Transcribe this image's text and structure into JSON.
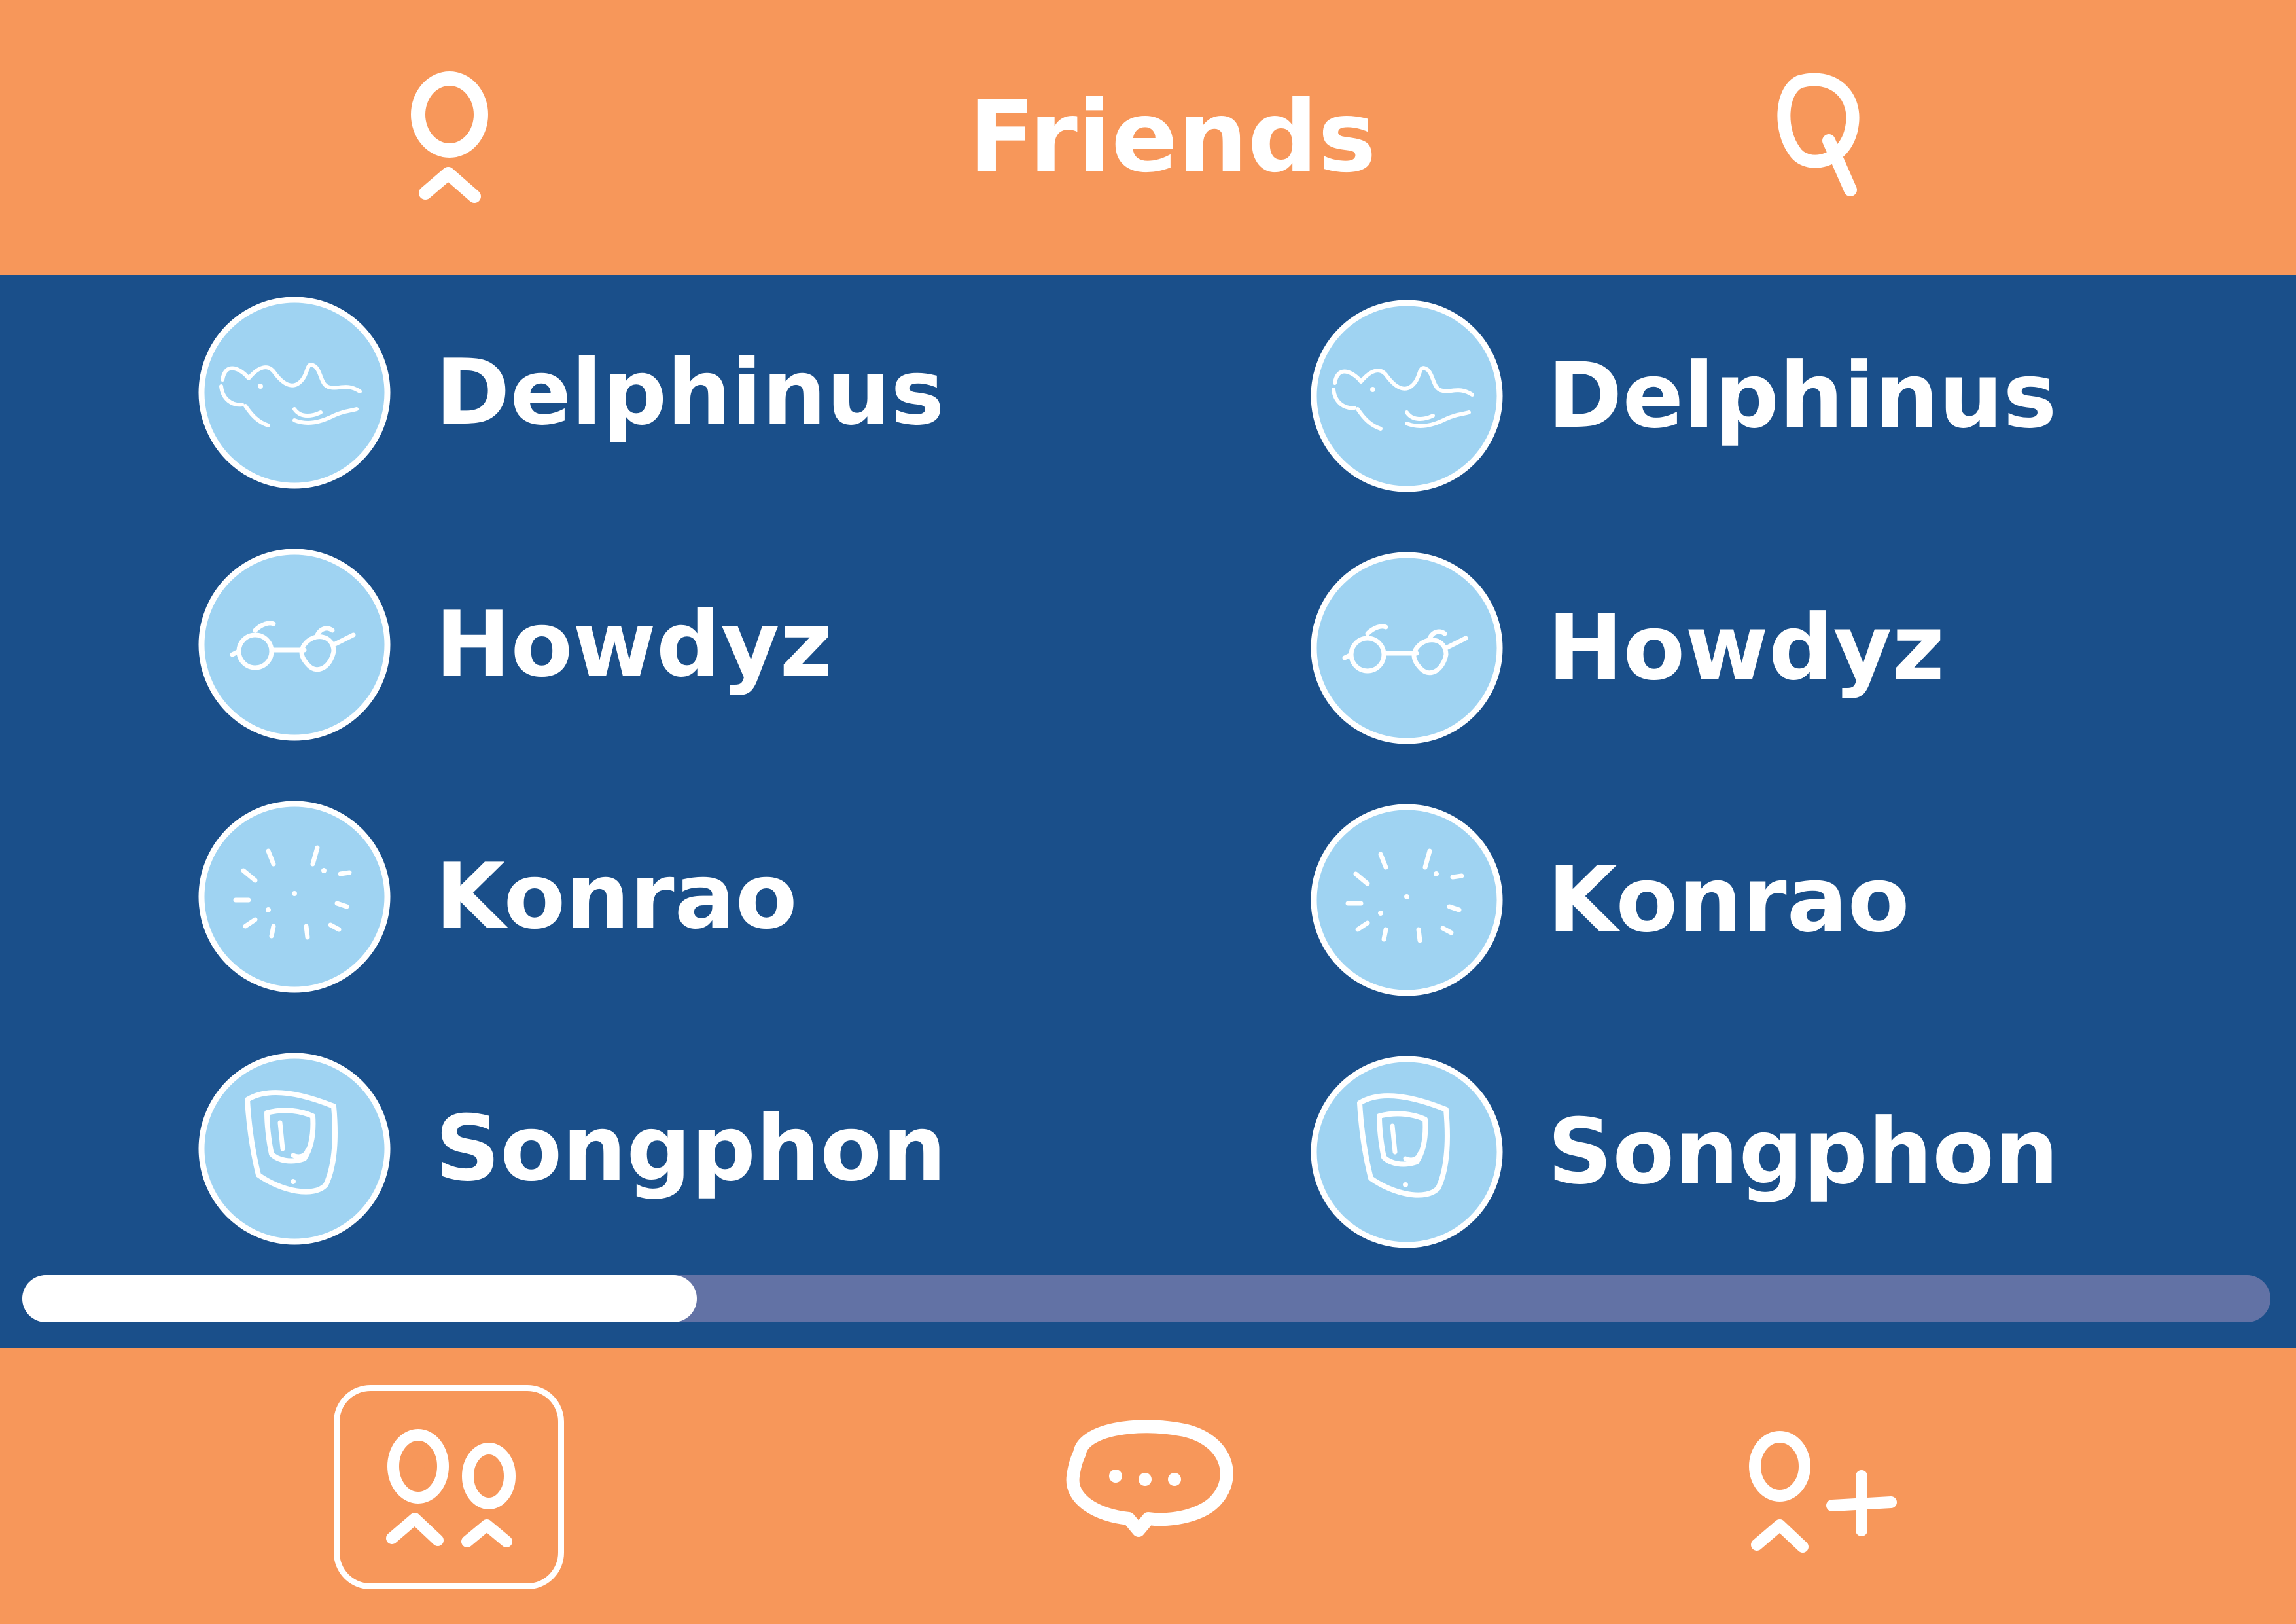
{
  "header": {
    "title": "Friends",
    "left_icon": "profile-icon",
    "right_icon": "search-icon"
  },
  "friends": [
    {
      "name": "Delphinus",
      "avatar_icon": "dolphin-icon"
    },
    {
      "name": "Howdyz",
      "avatar_icon": "glasses-icon"
    },
    {
      "name": "Konrao",
      "avatar_icon": "sparkle-icon"
    },
    {
      "name": "Songphon",
      "avatar_icon": "portrait-icon"
    },
    {
      "name": "Delphinus",
      "avatar_icon": "dolphin-icon"
    },
    {
      "name": "Howdyz",
      "avatar_icon": "glasses-icon"
    },
    {
      "name": "Konrao",
      "avatar_icon": "sparkle-icon"
    },
    {
      "name": "Songphon",
      "avatar_icon": "portrait-icon"
    }
  ],
  "scrollbar": {
    "position_fraction": 0.0,
    "visible_fraction": 0.3
  },
  "bottom_nav": [
    {
      "id": "friends",
      "icon": "friends-icon",
      "selected": true
    },
    {
      "id": "chat",
      "icon": "chat-icon",
      "selected": false
    },
    {
      "id": "add-friend",
      "icon": "add-friend-icon",
      "selected": false
    }
  ],
  "colors": {
    "bar": "#f7975a",
    "panel": "#1a4f8a",
    "avatar_fill": "#9fd3f2",
    "track": "#6272a5",
    "foreground": "#ffffff"
  }
}
